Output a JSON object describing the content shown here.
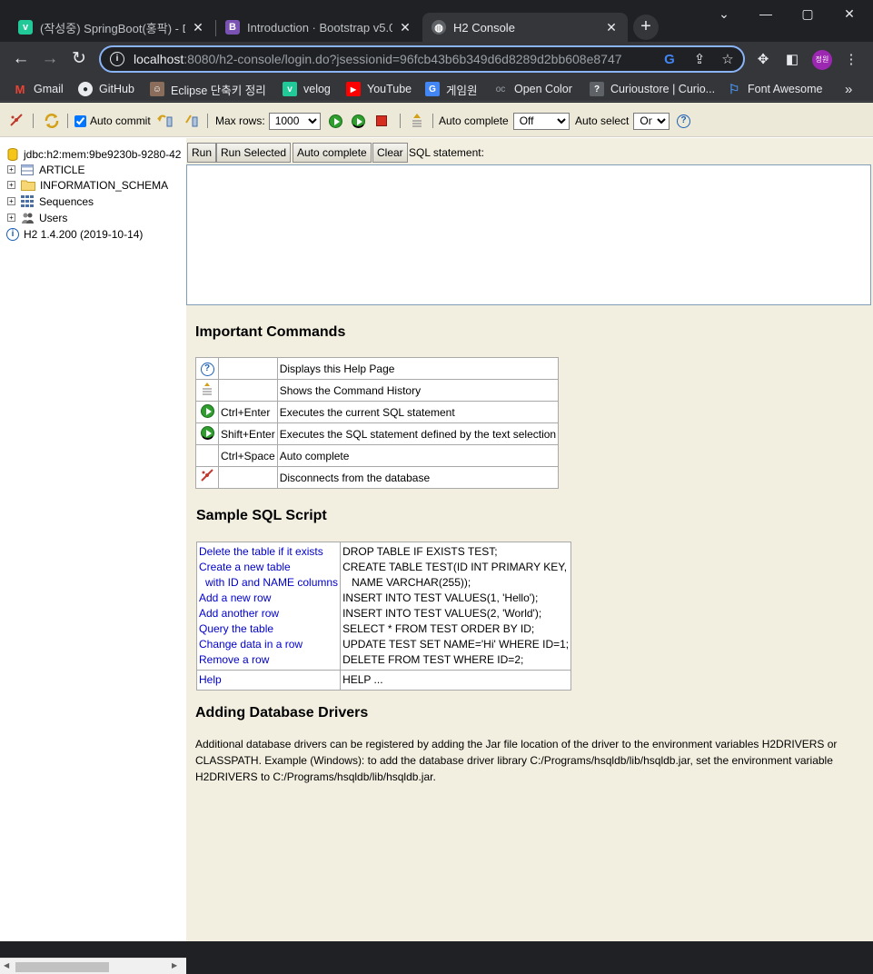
{
  "browser": {
    "tabs": [
      {
        "title": "(작성중) SpringBoot(홍팍) - D",
        "favicon_letter": "v",
        "favicon_color": "#20c997",
        "active": false
      },
      {
        "title": "Introduction · Bootstrap v5.0",
        "favicon_letter": "B",
        "favicon_color": "#7952b3",
        "active": false
      },
      {
        "title": "H2 Console",
        "favicon_letter": "",
        "favicon_color": "#9aa0a6",
        "active": true
      }
    ],
    "new_tab_label": "+",
    "window_controls": {
      "down": "⌄",
      "minimize": "—",
      "maximize": "▢",
      "close": "✕"
    },
    "url_host": "localhost",
    "url_rest": ":8080/h2-console/login.do?jsessionid=96fcb43b6b349d6d8289d2bb608e8747",
    "profile_label": "정원",
    "bookmarks": [
      {
        "label": "Gmail",
        "icon": "gmail-icon",
        "color": "#ea4335",
        "glyph": "M"
      },
      {
        "label": "GitHub",
        "icon": "github-icon",
        "color": "#24292e",
        "glyph": "●"
      },
      {
        "label": "Eclipse 단축키 정리",
        "icon": "eclipse-icon",
        "color": "#8a6d5a",
        "glyph": "☺"
      },
      {
        "label": "velog",
        "icon": "velog-icon",
        "color": "#20c997",
        "glyph": "v"
      },
      {
        "label": "YouTube",
        "icon": "youtube-icon",
        "color": "#ff0000",
        "glyph": "▶"
      },
      {
        "label": "게임원",
        "icon": "google-icon",
        "color": "#4285f4",
        "glyph": "G"
      },
      {
        "label": "Open Color",
        "icon": "opencolor-icon",
        "color": "#5f6368",
        "glyph": "oc"
      },
      {
        "label": "Curioustore | Curio...",
        "icon": "curioustore-icon",
        "color": "#5f6368",
        "glyph": "?"
      },
      {
        "label": "Font Awesome",
        "icon": "fontawesome-icon",
        "color": "#4a8fe7",
        "glyph": "⚐"
      }
    ],
    "bookmarks_more": "»"
  },
  "h2toolbar": {
    "auto_commit_label": "Auto commit",
    "auto_commit_checked": true,
    "max_rows_label": "Max rows:",
    "max_rows_value": "1000",
    "auto_complete_label": "Auto complete",
    "auto_complete_value": "Off",
    "auto_select_label": "Auto select",
    "auto_select_value": "On",
    "help_glyph": "?"
  },
  "tree": {
    "connection": "jdbc:h2:mem:9be9230b-9280-42",
    "nodes": [
      {
        "label": "ARTICLE",
        "icon": "table-icon"
      },
      {
        "label": "INFORMATION_SCHEMA",
        "icon": "folder-icon"
      },
      {
        "label": "Sequences",
        "icon": "sequence-icon"
      },
      {
        "label": "Users",
        "icon": "users-icon"
      }
    ],
    "version": "H2 1.4.200 (2019-10-14)",
    "info_glyph": "i",
    "expand_glyph": "+"
  },
  "sql_panel": {
    "run_label": "Run",
    "run_selected_label": "Run Selected",
    "auto_complete_label": "Auto complete",
    "clear_label": "Clear",
    "sql_statement_label": "SQL statement:",
    "statement": ""
  },
  "help": {
    "important_title": "Important Commands",
    "commands": [
      {
        "icon": "help-icon",
        "key": "",
        "desc": "Displays this Help Page"
      },
      {
        "icon": "history-icon",
        "key": "",
        "desc": "Shows the Command History"
      },
      {
        "icon": "run-icon",
        "key": "Ctrl+Enter",
        "desc": "Executes the current SQL statement"
      },
      {
        "icon": "run-selected-icon",
        "key": "Shift+Enter",
        "desc": "Executes the SQL statement defined by the text selection"
      },
      {
        "icon": "",
        "key": "Ctrl+Space",
        "desc": "Auto complete"
      },
      {
        "icon": "disconnect-icon",
        "key": "",
        "desc": "Disconnects from the database"
      }
    ],
    "sample_title": "Sample SQL Script",
    "sample_links": [
      "Delete the table if it exists",
      "Create a new table",
      "with ID and NAME columns",
      "Add a new row",
      "Add another row",
      "Query the table",
      "Change data in a row",
      "Remove a row"
    ],
    "sample_sql": [
      "DROP TABLE IF EXISTS TEST;",
      "CREATE TABLE TEST(ID INT PRIMARY KEY,",
      "NAME VARCHAR(255));",
      "INSERT INTO TEST VALUES(1, 'Hello');",
      "INSERT INTO TEST VALUES(2, 'World');",
      "SELECT * FROM TEST ORDER BY ID;",
      "UPDATE TEST SET NAME='Hi' WHERE ID=1;",
      "DELETE FROM TEST WHERE ID=2;"
    ],
    "help_link": "Help",
    "help_sql": "HELP ...",
    "drivers_title": "Adding Database Drivers",
    "drivers_text": "Additional database drivers can be registered by adding the Jar file location of the driver to the environment variables H2DRIVERS or CLASSPATH. Example (Windows): to add the database driver library C:/Programs/hsqldb/lib/hsqldb.jar, set the environment variable H2DRIVERS to C:/Programs/hsqldb/lib/hsqldb.jar."
  }
}
